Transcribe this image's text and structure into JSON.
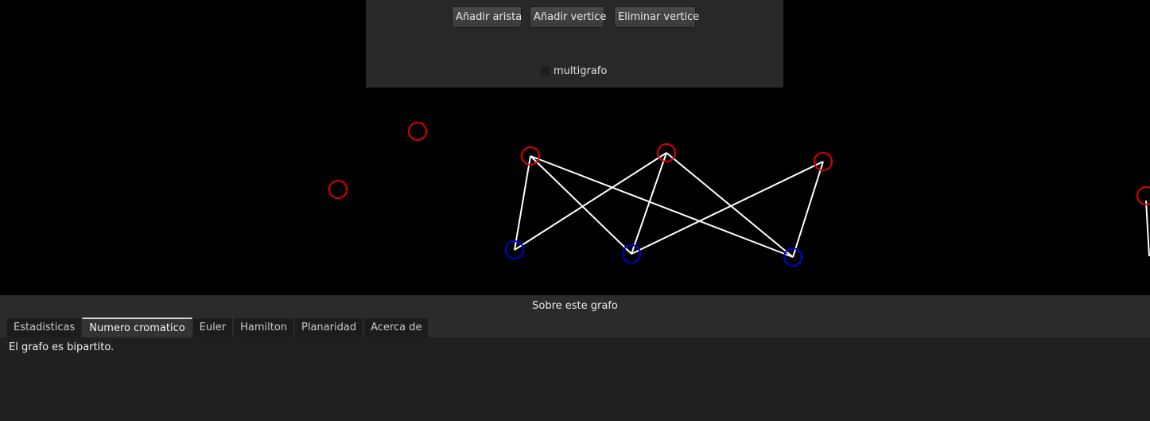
{
  "toolbar": {
    "add_edge_label": "Añadir arista",
    "add_vertex_label": "Añadir vertice",
    "delete_vertex_label": "Eliminar vertice",
    "multigraph_label": "multigrafo",
    "multigraph_checked": false
  },
  "graph": {
    "colors": {
      "red_vertex": "#e00000",
      "blue_vertex": "#0000e0",
      "edge": "#ffffff"
    }
  },
  "panel": {
    "title": "Sobre este grafo",
    "tabs": [
      {
        "label": "Estadisticas",
        "active": false
      },
      {
        "label": "Numero cromatico",
        "active": true
      },
      {
        "label": "Euler",
        "active": false
      },
      {
        "label": "Hamilton",
        "active": false
      },
      {
        "label": "Planaridad",
        "active": false
      },
      {
        "label": "Acerca de",
        "active": false
      }
    ],
    "content_text": "El grafo es bipartito."
  }
}
